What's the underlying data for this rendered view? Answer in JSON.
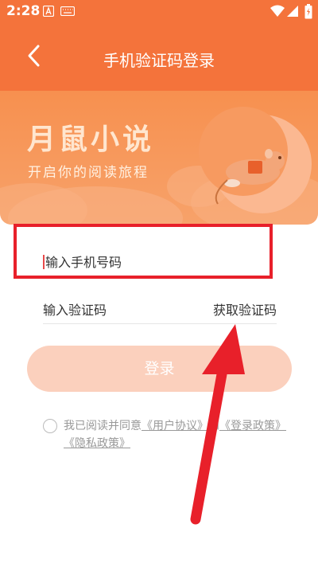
{
  "status_bar": {
    "time": "2:28",
    "icons": [
      "notification-a-icon",
      "keyboard-icon",
      "wifi-icon",
      "signal-icon",
      "battery-charging-icon"
    ]
  },
  "nav": {
    "back_icon": "chevron-left-icon",
    "title": "手机验证码登录"
  },
  "banner": {
    "title": "月鼠小说",
    "subtitle": "开启你的阅读旅程"
  },
  "form": {
    "phone_placeholder": "输入手机号码",
    "code_placeholder": "输入验证码",
    "get_code_label": "获取验证码",
    "login_label": "登录"
  },
  "agreement": {
    "prefix": "我已阅读并同意",
    "user_agreement": "《用户协议》",
    "and": "和",
    "login_policy": "《登录政策》",
    "privacy_policy": "《隐私政策》"
  },
  "colors": {
    "brand_orange": "#f4733b",
    "login_button_disabled": "#fbd0bd",
    "annotation_red": "#e8202a"
  }
}
